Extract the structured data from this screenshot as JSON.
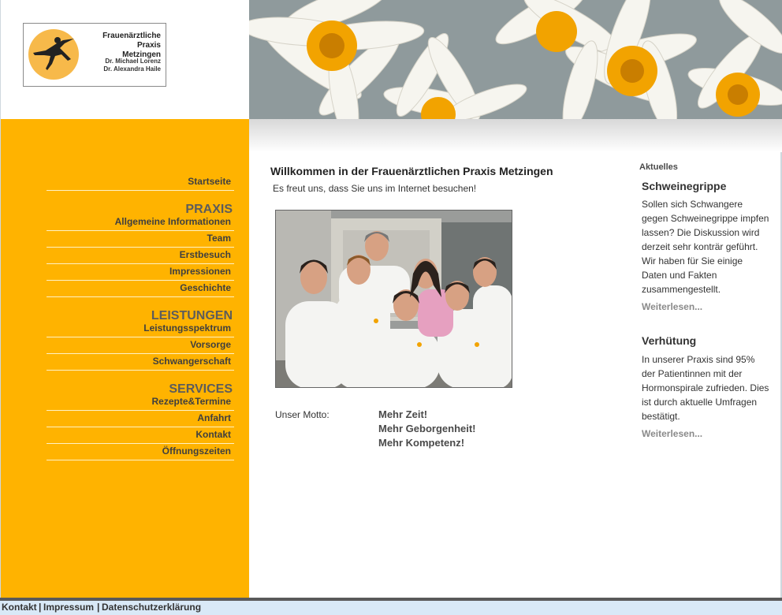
{
  "logo": {
    "title_line1": "Frauenärztliche Praxis",
    "title_line2": "Metzingen",
    "name1": "Dr. Michael Lorenz",
    "name2": "Dr. Alexandra Haile"
  },
  "nav": {
    "startseite": "Startseite",
    "praxis_head": "PRAXIS",
    "praxis_items": [
      "Allgemeine Informationen",
      "Team",
      "Erstbesuch",
      "Impressionen",
      "Geschichte"
    ],
    "leistungen_head": "LEISTUNGEN",
    "leistungen_items": [
      "Leistungsspektrum",
      "Vorsorge",
      "Schwangerschaft"
    ],
    "services_head": "SERVICES",
    "services_items": [
      "Rezepte&Termine",
      "Anfahrt",
      "Kontakt",
      "Öffnungszeiten"
    ]
  },
  "main": {
    "title": "Willkommen in der Frauenärztlichen Praxis Metzingen",
    "subtitle": "Es freut uns, dass Sie uns im Internet besuchen!",
    "motto_label": "Unser Motto:",
    "motto": [
      "Mehr Zeit!",
      "Mehr Geborgenheit!",
      "Mehr Kompetenz!"
    ]
  },
  "news": {
    "label": "Aktuelles",
    "items": [
      {
        "title": "Schweinegrippe",
        "text": "Sollen sich Schwangere gegen Schweinegrippe impfen lassen? Die Diskussion wird derzeit sehr konträr geführt. Wir haben für Sie einige Daten und Fakten zusammengestellt.",
        "more": "Weiterlesen..."
      },
      {
        "title": "Verhütung",
        "text": "In unserer Praxis sind 95% der Patientinnen mit der Hormonspirale zufrieden. Dies ist durch aktuelle Umfragen bestätigt.",
        "more": "Weiterlesen..."
      }
    ]
  },
  "footer": {
    "kontakt": "Kontakt",
    "sep": "|",
    "impressum": "Impressum",
    "datenschutz": "Datenschutzerklärung"
  },
  "colors": {
    "sidebar": "#ffb300",
    "footer": "#d9e9f7",
    "logo_circle": "#f7b94a"
  }
}
